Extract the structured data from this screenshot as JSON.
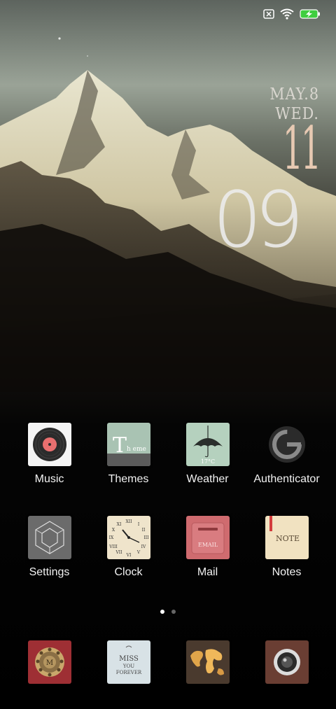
{
  "status_bar": {
    "icons": [
      "sim-off-icon",
      "wifi-icon",
      "battery-charging-icon"
    ]
  },
  "clock_widget": {
    "date": "MAY.8",
    "weekday": "WED.",
    "hour": "11",
    "minute": "09"
  },
  "apps_row1": [
    {
      "label": "Music",
      "icon": "vinyl-record-icon"
    },
    {
      "label": "Themes",
      "icon": "theme-icon"
    },
    {
      "label": "Weather",
      "icon": "umbrella-icon"
    },
    {
      "label": "Authenticator",
      "icon": "authenticator-g-icon"
    }
  ],
  "apps_row2": [
    {
      "label": "Settings",
      "icon": "hexagon-cube-icon"
    },
    {
      "label": "Clock",
      "icon": "roman-clock-icon"
    },
    {
      "label": "Mail",
      "icon": "mailbox-icon"
    },
    {
      "label": "Notes",
      "icon": "notepad-icon"
    }
  ],
  "icon_text": {
    "theme_big": "T",
    "theme_small": "h eme",
    "weather_temp": "17°C",
    "mail_text": "EMAIL",
    "notes_text": "NOTE",
    "phone_letter": "M",
    "miss_line1": "MISS",
    "miss_line2": "YOU",
    "miss_line3": "FOREVER"
  },
  "page_indicator": {
    "pages": 2,
    "current": 1
  },
  "dock": [
    {
      "icon": "rotary-phone-icon"
    },
    {
      "icon": "miss-you-forever-icon"
    },
    {
      "icon": "world-map-icon"
    },
    {
      "icon": "camera-lens-icon"
    }
  ],
  "colors": {
    "label_text": "#f2f2f2",
    "clock_hour": "#e7c9b2",
    "dot_active": "#ffffff",
    "dot_inactive": "#666666"
  }
}
